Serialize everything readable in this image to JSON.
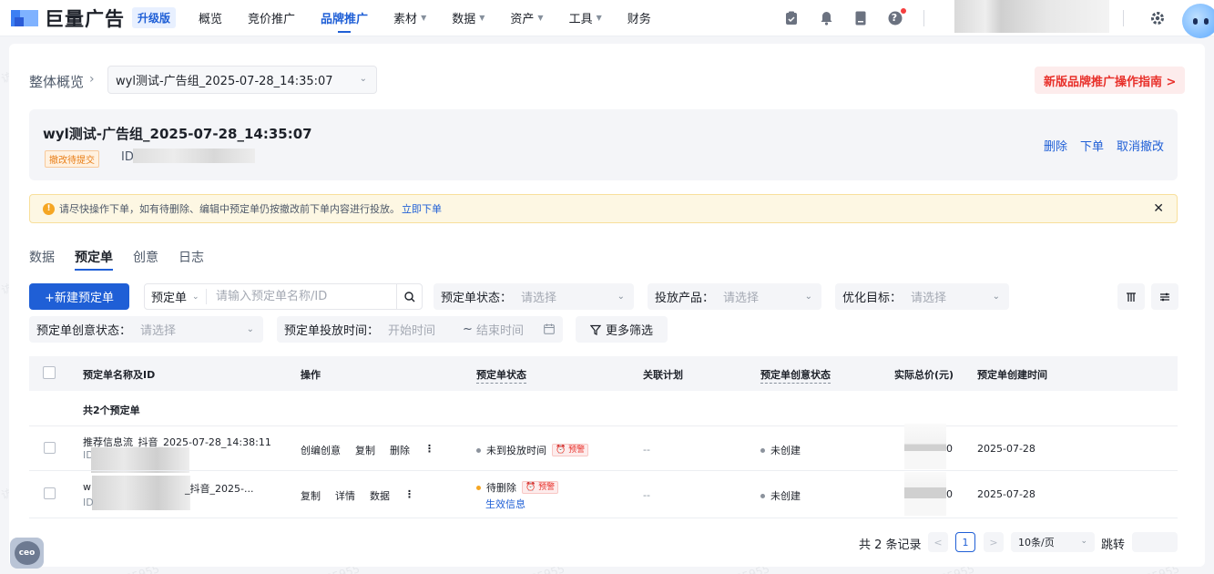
{
  "nav": {
    "brand": "巨量广告",
    "badge": "升级版",
    "items": [
      {
        "label": "概览",
        "caret": false,
        "active": false
      },
      {
        "label": "竞价推广",
        "caret": false,
        "active": false
      },
      {
        "label": "品牌推广",
        "caret": false,
        "active": true
      },
      {
        "label": "素材",
        "caret": true,
        "active": false
      },
      {
        "label": "数据",
        "caret": true,
        "active": false
      },
      {
        "label": "资产",
        "caret": true,
        "active": false
      },
      {
        "label": "工具",
        "caret": true,
        "active": false
      },
      {
        "label": "财务",
        "caret": false,
        "active": false
      }
    ],
    "help_glyph": "?"
  },
  "breadcrumb": {
    "root": "整体概览",
    "selected": "wyl测试-广告组_2025-07-28_14:35:07"
  },
  "guide_button": "新版品牌推广操作指南 >",
  "summary": {
    "title": "wyl测试-广告组_2025-07-28_14:35:07",
    "badge": "撤改待提交",
    "id_label": "ID",
    "actions": [
      "删除",
      "下单",
      "取消撤改"
    ]
  },
  "alert": {
    "text": "请尽快操作下单，如有待删除、编辑中预定单仍按撤改前下单内容进行投放。",
    "link": "立即下单",
    "icon_glyph": "!",
    "close_glyph": "✕"
  },
  "tabs": [
    {
      "label": "数据",
      "active": false
    },
    {
      "label": "预定单",
      "active": true
    },
    {
      "label": "创意",
      "active": false
    },
    {
      "label": "日志",
      "active": false
    }
  ],
  "filters": {
    "new_button": "+新建预定单",
    "search_type": "预定单",
    "search_placeholder": "请输入预定单名称/ID",
    "status_label": "预定单状态：",
    "status_placeholder": "请选择",
    "product_label": "投放产品：",
    "product_placeholder": "请选择",
    "goal_label": "优化目标：",
    "goal_placeholder": "请选择",
    "creative_status_label": "预定单创意状态：",
    "creative_status_placeholder": "请选择",
    "time_label": "预定单投放时间：",
    "start_placeholder": "开始时间",
    "separator": "~",
    "end_placeholder": "结束时间",
    "more_button": "更多筛选"
  },
  "table": {
    "columns": [
      "预定单名称及ID",
      "操作",
      "预定单状态",
      "关联计划",
      "预定单创意状态",
      "实际总价(元)",
      "预定单创建时间"
    ],
    "count_label": "共2个预定单",
    "rows": [
      {
        "name": "推荐信息流_抖音_2025-07-28_14:38:11",
        "id_label": "ID",
        "actions": [
          "创编创意",
          "复制",
          "删除"
        ],
        "more_glyph": "⋮",
        "status": "未到投放时间",
        "status_color": "#8c939d",
        "warning": "预警",
        "status_link": "",
        "plan": "--",
        "creative_status": "未创建",
        "price_suffix": "0",
        "created": "2025-07-28"
      },
      {
        "name_prefix": "w",
        "name_suffix": "_抖音_2025-...",
        "id_label": "ID",
        "actions": [
          "复制",
          "详情",
          "数据"
        ],
        "more_glyph": "⋮",
        "status": "待删除",
        "status_color": "#f5a623",
        "warning": "预警",
        "status_link": "生效信息",
        "plan": "--",
        "creative_status": "未创建",
        "price_suffix": "0",
        "created": "2025-07-28"
      }
    ]
  },
  "pagination": {
    "total": "共 2 条记录",
    "prev": "<",
    "current": "1",
    "next": ">",
    "page_size": "10条/页",
    "jump_label": "跳转"
  },
  "bot_glyph": "ceo",
  "watermark": "访客 85955"
}
